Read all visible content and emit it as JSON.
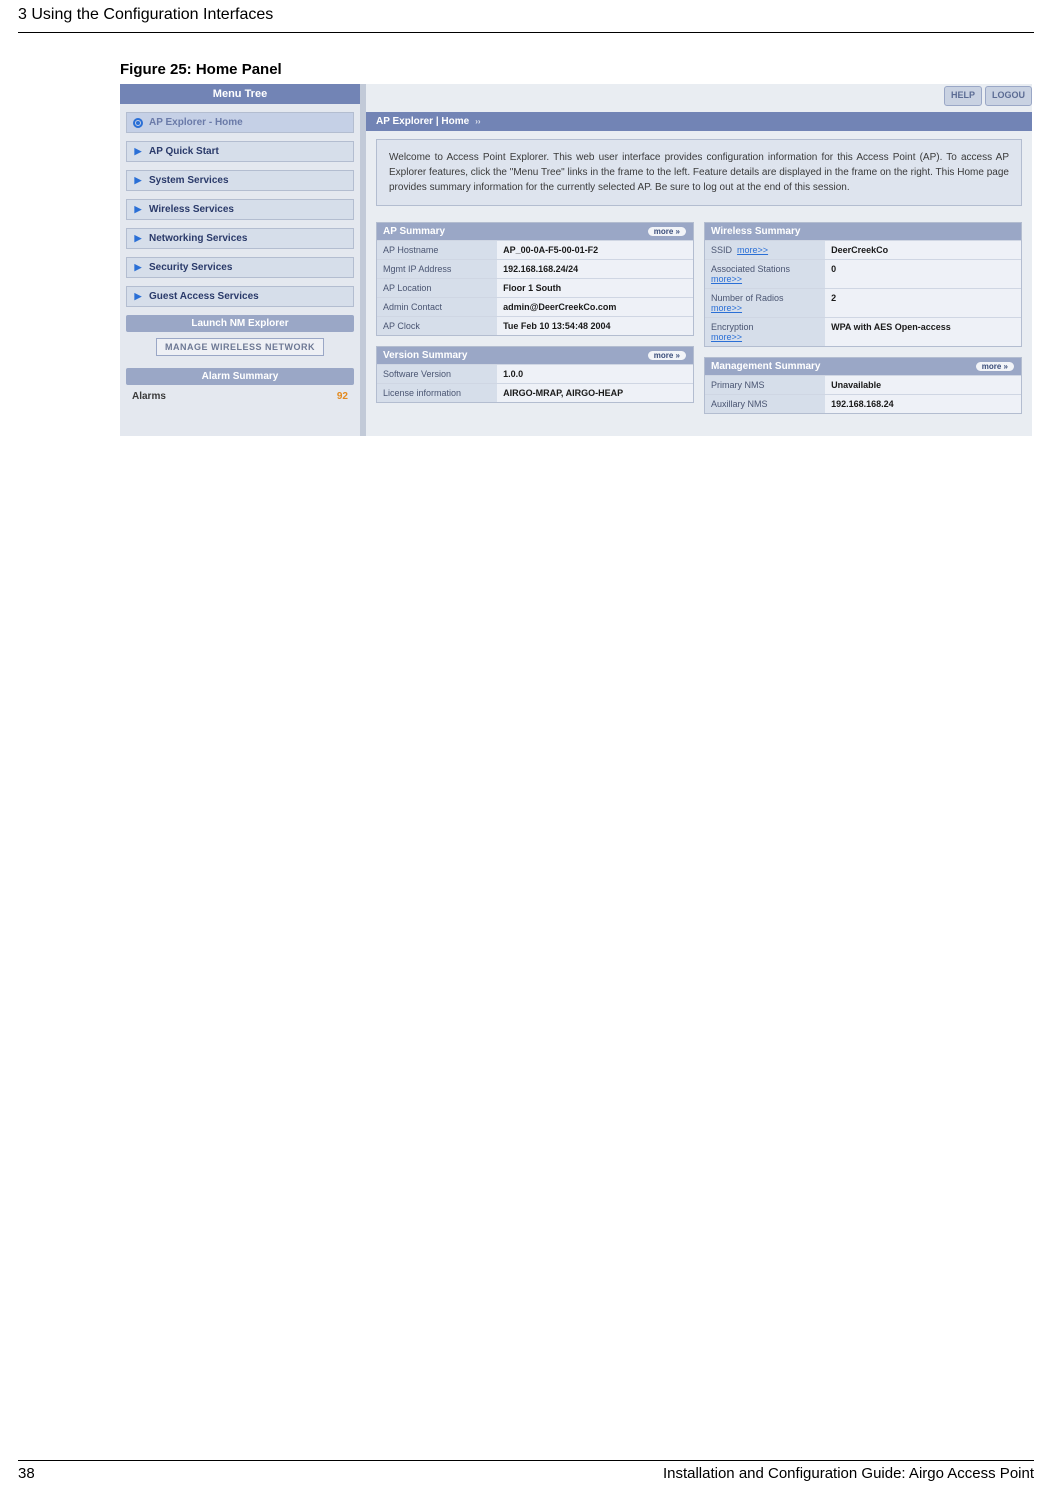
{
  "page": {
    "chapter_heading": "3  Using the Configuration Interfaces",
    "figure_caption": "Figure 25:      Home Panel",
    "page_number": "38",
    "footer_title": "Installation and Configuration Guide: Airgo Access Point"
  },
  "sidebar": {
    "menu_title": "Menu Tree",
    "items": [
      {
        "label": "AP Explorer - Home",
        "active": true
      },
      {
        "label": "AP Quick Start"
      },
      {
        "label": "System Services"
      },
      {
        "label": "Wireless Services"
      },
      {
        "label": "Networking Services"
      },
      {
        "label": "Security Services"
      },
      {
        "label": "Guest Access Services"
      }
    ],
    "launch_label": "Launch NM Explorer",
    "manage_button": "MANAGE WIRELESS NETWORK",
    "alarm_title": "Alarm Summary",
    "alarm_label": "Alarms",
    "alarm_count": "92"
  },
  "topbar": {
    "help": "HELP",
    "logout": "LOGOU"
  },
  "breadcrumb": {
    "text": "AP Explorer | Home"
  },
  "welcome": {
    "text": "Welcome to Access Point Explorer. This web user interface provides configuration information for this Access Point (AP). To access AP Explorer features, click the \"Menu Tree\" links in the frame to the left. Feature details are displayed in the frame on the right. This Home page provides summary information for the currently selected AP. Be sure to log out at the end of this session."
  },
  "panels": {
    "more_label": "more »",
    "more_link_label": "more>>",
    "ap_summary": {
      "title": "AP Summary",
      "rows": [
        {
          "k": "AP Hostname",
          "v": "AP_00-0A-F5-00-01-F2"
        },
        {
          "k": "Mgmt IP Address",
          "v": "192.168.168.24/24"
        },
        {
          "k": "AP Location",
          "v": "Floor 1 South"
        },
        {
          "k": "Admin Contact",
          "v": "admin@DeerCreekCo.com"
        },
        {
          "k": "AP Clock",
          "v": "Tue Feb 10 13:54:48 2004"
        }
      ]
    },
    "version_summary": {
      "title": "Version Summary",
      "rows": [
        {
          "k": "Software Version",
          "v": "1.0.0"
        },
        {
          "k": "License information",
          "v": "AIRGO-MRAP, AIRGO-HEAP"
        }
      ]
    },
    "wireless_summary": {
      "title": "Wireless Summary",
      "rows": [
        {
          "k": "SSID",
          "v": "DeerCreekCo",
          "link": true
        },
        {
          "k": "Associated Stations",
          "v": "0",
          "link_below": true
        },
        {
          "k": "Number of Radios",
          "v": "2",
          "link_below": true
        },
        {
          "k": "Encryption",
          "v": "WPA with AES Open-access",
          "link_below": true
        }
      ]
    },
    "management_summary": {
      "title": "Management Summary",
      "rows": [
        {
          "k": "Primary NMS",
          "v": "Unavailable"
        },
        {
          "k": "Auxillary NMS",
          "v": "192.168.168.24"
        }
      ]
    }
  }
}
